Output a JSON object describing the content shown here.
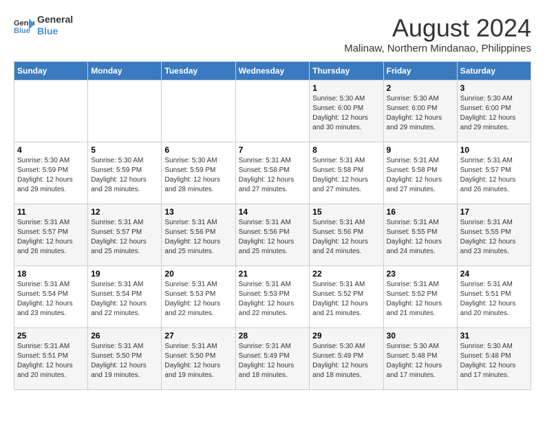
{
  "logo": {
    "line1": "General",
    "line2": "Blue"
  },
  "title": {
    "month_year": "August 2024",
    "location": "Malinaw, Northern Mindanao, Philippines"
  },
  "headers": [
    "Sunday",
    "Monday",
    "Tuesday",
    "Wednesday",
    "Thursday",
    "Friday",
    "Saturday"
  ],
  "weeks": [
    [
      {
        "day": "",
        "info": ""
      },
      {
        "day": "",
        "info": ""
      },
      {
        "day": "",
        "info": ""
      },
      {
        "day": "",
        "info": ""
      },
      {
        "day": "1",
        "info": "Sunrise: 5:30 AM\nSunset: 6:00 PM\nDaylight: 12 hours\nand 30 minutes."
      },
      {
        "day": "2",
        "info": "Sunrise: 5:30 AM\nSunset: 6:00 PM\nDaylight: 12 hours\nand 29 minutes."
      },
      {
        "day": "3",
        "info": "Sunrise: 5:30 AM\nSunset: 6:00 PM\nDaylight: 12 hours\nand 29 minutes."
      }
    ],
    [
      {
        "day": "4",
        "info": "Sunrise: 5:30 AM\nSunset: 5:59 PM\nDaylight: 12 hours\nand 29 minutes."
      },
      {
        "day": "5",
        "info": "Sunrise: 5:30 AM\nSunset: 5:59 PM\nDaylight: 12 hours\nand 28 minutes."
      },
      {
        "day": "6",
        "info": "Sunrise: 5:30 AM\nSunset: 5:59 PM\nDaylight: 12 hours\nand 28 minutes."
      },
      {
        "day": "7",
        "info": "Sunrise: 5:31 AM\nSunset: 5:58 PM\nDaylight: 12 hours\nand 27 minutes."
      },
      {
        "day": "8",
        "info": "Sunrise: 5:31 AM\nSunset: 5:58 PM\nDaylight: 12 hours\nand 27 minutes."
      },
      {
        "day": "9",
        "info": "Sunrise: 5:31 AM\nSunset: 5:58 PM\nDaylight: 12 hours\nand 27 minutes."
      },
      {
        "day": "10",
        "info": "Sunrise: 5:31 AM\nSunset: 5:57 PM\nDaylight: 12 hours\nand 26 minutes."
      }
    ],
    [
      {
        "day": "11",
        "info": "Sunrise: 5:31 AM\nSunset: 5:57 PM\nDaylight: 12 hours\nand 26 minutes."
      },
      {
        "day": "12",
        "info": "Sunrise: 5:31 AM\nSunset: 5:57 PM\nDaylight: 12 hours\nand 25 minutes."
      },
      {
        "day": "13",
        "info": "Sunrise: 5:31 AM\nSunset: 5:56 PM\nDaylight: 12 hours\nand 25 minutes."
      },
      {
        "day": "14",
        "info": "Sunrise: 5:31 AM\nSunset: 5:56 PM\nDaylight: 12 hours\nand 25 minutes."
      },
      {
        "day": "15",
        "info": "Sunrise: 5:31 AM\nSunset: 5:56 PM\nDaylight: 12 hours\nand 24 minutes."
      },
      {
        "day": "16",
        "info": "Sunrise: 5:31 AM\nSunset: 5:55 PM\nDaylight: 12 hours\nand 24 minutes."
      },
      {
        "day": "17",
        "info": "Sunrise: 5:31 AM\nSunset: 5:55 PM\nDaylight: 12 hours\nand 23 minutes."
      }
    ],
    [
      {
        "day": "18",
        "info": "Sunrise: 5:31 AM\nSunset: 5:54 PM\nDaylight: 12 hours\nand 23 minutes."
      },
      {
        "day": "19",
        "info": "Sunrise: 5:31 AM\nSunset: 5:54 PM\nDaylight: 12 hours\nand 22 minutes."
      },
      {
        "day": "20",
        "info": "Sunrise: 5:31 AM\nSunset: 5:53 PM\nDaylight: 12 hours\nand 22 minutes."
      },
      {
        "day": "21",
        "info": "Sunrise: 5:31 AM\nSunset: 5:53 PM\nDaylight: 12 hours\nand 22 minutes."
      },
      {
        "day": "22",
        "info": "Sunrise: 5:31 AM\nSunset: 5:52 PM\nDaylight: 12 hours\nand 21 minutes."
      },
      {
        "day": "23",
        "info": "Sunrise: 5:31 AM\nSunset: 5:52 PM\nDaylight: 12 hours\nand 21 minutes."
      },
      {
        "day": "24",
        "info": "Sunrise: 5:31 AM\nSunset: 5:51 PM\nDaylight: 12 hours\nand 20 minutes."
      }
    ],
    [
      {
        "day": "25",
        "info": "Sunrise: 5:31 AM\nSunset: 5:51 PM\nDaylight: 12 hours\nand 20 minutes."
      },
      {
        "day": "26",
        "info": "Sunrise: 5:31 AM\nSunset: 5:50 PM\nDaylight: 12 hours\nand 19 minutes."
      },
      {
        "day": "27",
        "info": "Sunrise: 5:31 AM\nSunset: 5:50 PM\nDaylight: 12 hours\nand 19 minutes."
      },
      {
        "day": "28",
        "info": "Sunrise: 5:31 AM\nSunset: 5:49 PM\nDaylight: 12 hours\nand 18 minutes."
      },
      {
        "day": "29",
        "info": "Sunrise: 5:30 AM\nSunset: 5:49 PM\nDaylight: 12 hours\nand 18 minutes."
      },
      {
        "day": "30",
        "info": "Sunrise: 5:30 AM\nSunset: 5:48 PM\nDaylight: 12 hours\nand 17 minutes."
      },
      {
        "day": "31",
        "info": "Sunrise: 5:30 AM\nSunset: 5:48 PM\nDaylight: 12 hours\nand 17 minutes."
      }
    ]
  ]
}
